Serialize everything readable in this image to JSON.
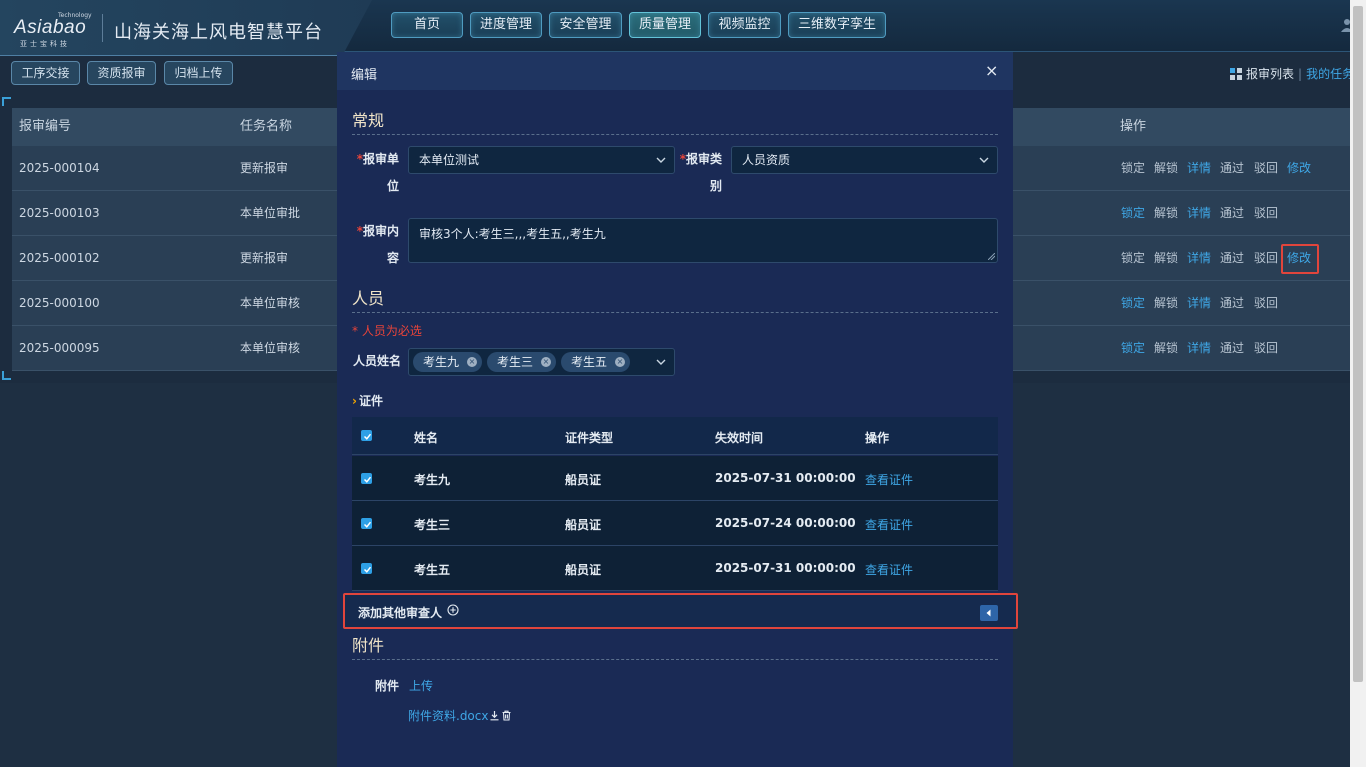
{
  "header": {
    "logo_text": "Asiabao",
    "logo_tech": "Technology",
    "logo_cn": "亚士宝科技",
    "platform_title": "山海关海上风电智慧平台",
    "nav": [
      {
        "label": "首页",
        "active": false
      },
      {
        "label": "进度管理",
        "active": false
      },
      {
        "label": "安全管理",
        "active": false
      },
      {
        "label": "质量管理",
        "active": true
      },
      {
        "label": "视频监控",
        "active": false
      },
      {
        "label": "三维数字孪生",
        "active": false
      }
    ]
  },
  "subbar": {
    "buttons": [
      "工序交接",
      "资质报审",
      "归档上传"
    ],
    "list_link": "报审列表",
    "my_task_link": "我的任务"
  },
  "table": {
    "columns": [
      "报审编号",
      "任务名称",
      "操作"
    ],
    "rows": [
      {
        "id": "2025-000104",
        "task": "更新报审",
        "lock_active": false,
        "has_edit": true
      },
      {
        "id": "2025-000103",
        "task": "本单位审批",
        "lock_active": true,
        "has_edit": false
      },
      {
        "id": "2025-000102",
        "task": "更新报审",
        "lock_active": false,
        "has_edit": true
      },
      {
        "id": "2025-000100",
        "task": "本单位审核",
        "lock_active": true,
        "has_edit": false
      },
      {
        "id": "2025-000095",
        "task": "本单位审核",
        "lock_active": true,
        "has_edit": false
      }
    ],
    "actions": {
      "lock": "锁定",
      "unlock": "解锁",
      "detail": "详情",
      "pass": "通过",
      "reject": "驳回",
      "edit": "修改"
    }
  },
  "modal": {
    "title": "编辑",
    "close": "×",
    "general": {
      "section_title": "常规",
      "unit_label_line1": "报审单",
      "unit_label_line2": "位",
      "unit_value": "本单位测试",
      "type_label_line1": "报审类",
      "type_label_line2": "别",
      "type_value": "人员资质",
      "content_label_line1": "报审内",
      "content_label_line2": "容",
      "content_value": "审核3个人:考生三,,,考生五,,考生九",
      "required_mark": "*"
    },
    "personnel": {
      "section_title": "人员",
      "required_tip": "* 人员为必选",
      "name_label": "人员姓名",
      "tags": [
        "考生九",
        "考生三",
        "考生五"
      ],
      "cert_title": "证件",
      "cert_columns": [
        "姓名",
        "证件类型",
        "失效时间",
        "操作"
      ],
      "cert_rows": [
        {
          "name": "考生九",
          "type": "船员证",
          "expire": "2025-07-31 00:00:00",
          "action": "查看证件",
          "checked": true
        },
        {
          "name": "考生三",
          "type": "船员证",
          "expire": "2025-07-24 00:00:00",
          "action": "查看证件",
          "checked": true
        },
        {
          "name": "考生五",
          "type": "船员证",
          "expire": "2025-07-31 00:00:00",
          "action": "查看证件",
          "checked": true
        }
      ],
      "add_reviewer": "添加其他审查人"
    },
    "attachment": {
      "section_title": "附件",
      "label": "附件",
      "upload": "上传",
      "file_name": "附件资料.docx"
    }
  },
  "colors": {
    "accent_blue": "#3fa7e6",
    "highlight_red": "#e0453c",
    "required_red": "#e8443a",
    "section_title": "#f0e4c8"
  }
}
